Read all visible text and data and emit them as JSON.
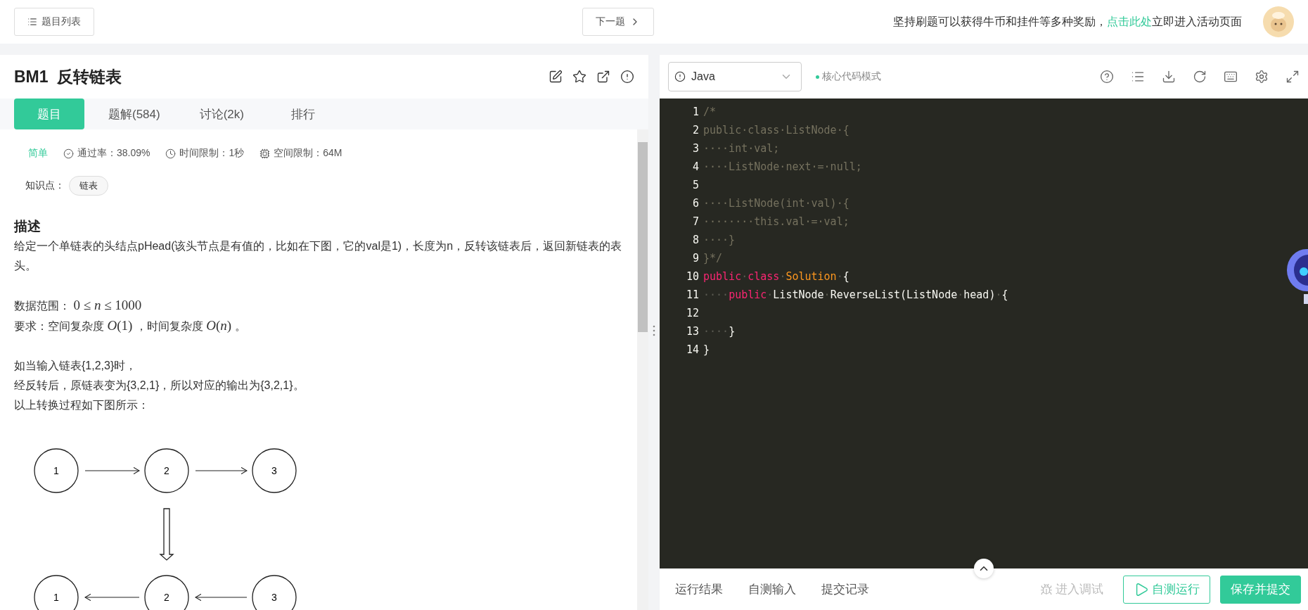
{
  "top_bar": {
    "problem_list_button": "题目列表",
    "next_button": "下一题",
    "banner": {
      "before": "坚持刷题可以获得牛币和挂件等多种奖励，",
      "link": "点击此处",
      "after": "立即进入活动页面"
    }
  },
  "problem": {
    "title": "BM1  反转链表",
    "tabs": [
      {
        "label": "题目",
        "selected": true
      },
      {
        "label": "题解(584)",
        "selected": false
      },
      {
        "label": "讨论(2k)",
        "selected": false
      },
      {
        "label": "排行",
        "selected": false
      }
    ],
    "difficulty": "简单",
    "meta": [
      {
        "kind": "pass-rate",
        "text": "通过率：38.09%"
      },
      {
        "kind": "time",
        "text": "时间限制：1秒"
      },
      {
        "kind": "memory",
        "text": "空间限制：64M"
      }
    ],
    "knowledge_label": "知识点：",
    "tags": [
      "链表"
    ],
    "description": {
      "heading": "描述",
      "paragraphs": [
        [
          [
            {
              "kind": "text",
              "text": "给定一个单链表的头结点pHead(该头节点是有值的，比如在下图，它的val是1)，长度为n，反转该链表后，返回新链表的表头。"
            }
          ]
        ],
        [
          [
            {
              "kind": "text",
              "text": "数据范围： "
            },
            {
              "kind": "math",
              "text": "0 ≤ *n* ≤ 1000"
            }
          ],
          [
            {
              "kind": "text",
              "text": "要求：空间复杂度 "
            },
            {
              "kind": "math",
              "text": "*O*(1)"
            },
            {
              "kind": "text",
              "text": " ，时间复杂度 "
            },
            {
              "kind": "math",
              "text": "*O*(*n*)"
            },
            {
              "kind": "text",
              "text": " 。"
            }
          ]
        ],
        [
          [
            {
              "kind": "text",
              "text": "如当输入链表{1,2,3}时，"
            }
          ],
          [
            {
              "kind": "text",
              "text": "经反转后，原链表变为{3,2,1}，所以对应的输出为{3,2,1}。"
            }
          ],
          [
            {
              "kind": "text",
              "text": "以上转换过程如下图所示："
            }
          ]
        ]
      ]
    },
    "diagram": {
      "rows": [
        {
          "kind": "forward",
          "nodes": [
            "1",
            "2",
            "3"
          ]
        },
        {
          "kind": "backward",
          "nodes": [
            "1",
            "2",
            "3"
          ]
        }
      ]
    }
  },
  "editor": {
    "language": "Java",
    "mode": "核心代码模式",
    "lines": [
      {
        "number": "1",
        "tokens": [
          {
            "kind": "comment",
            "text": "/*"
          }
        ]
      },
      {
        "number": "2",
        "tokens": [
          {
            "kind": "comment",
            "text": "public·class·ListNode·{"
          }
        ]
      },
      {
        "number": "3",
        "tokens": [
          {
            "kind": "comment",
            "text": "····int·val;"
          }
        ]
      },
      {
        "number": "4",
        "tokens": [
          {
            "kind": "comment",
            "text": "····ListNode·next·=·null;"
          }
        ]
      },
      {
        "number": "5"
      },
      {
        "number": "6",
        "tokens": [
          {
            "kind": "comment",
            "text": "····ListNode(int·val)·{"
          }
        ]
      },
      {
        "number": "7",
        "tokens": [
          {
            "kind": "comment",
            "text": "········this.val·=·val;"
          }
        ]
      },
      {
        "number": "8",
        "tokens": [
          {
            "kind": "comment",
            "text": "····}"
          }
        ]
      },
      {
        "number": "9",
        "tokens": [
          {
            "kind": "comment",
            "text": "}*/"
          }
        ]
      },
      {
        "number": "10",
        "tokens": [
          {
            "kind": "keyword",
            "text": "public"
          },
          {
            "kind": "space",
            "text": "·"
          },
          {
            "kind": "keyword",
            "text": "class"
          },
          {
            "kind": "space",
            "text": "·"
          },
          {
            "kind": "type",
            "text": "Solution"
          },
          {
            "kind": "space",
            "text": "·"
          },
          {
            "kind": "plain",
            "text": "{"
          }
        ]
      },
      {
        "number": "11",
        "tokens": [
          {
            "kind": "space",
            "text": "····"
          },
          {
            "kind": "keyword",
            "text": "public"
          },
          {
            "kind": "space",
            "text": "·"
          },
          {
            "kind": "plain",
            "text": "ListNode"
          },
          {
            "kind": "space",
            "text": "·"
          },
          {
            "kind": "plain",
            "text": "ReverseList(ListNode"
          },
          {
            "kind": "space",
            "text": "·"
          },
          {
            "kind": "plain",
            "text": "head)"
          },
          {
            "kind": "space",
            "text": "·"
          },
          {
            "kind": "plain",
            "text": "{"
          }
        ]
      },
      {
        "number": "12"
      },
      {
        "number": "13",
        "tokens": [
          {
            "kind": "space",
            "text": "····"
          },
          {
            "kind": "plain",
            "text": "}"
          }
        ]
      },
      {
        "number": "14",
        "tokens": [
          {
            "kind": "plain",
            "text": "}"
          }
        ]
      }
    ]
  },
  "bottom_bar": {
    "tabs": [
      "运行结果",
      "自测输入",
      "提交记录"
    ],
    "buttons": [
      {
        "kind": "debug",
        "label": "进入调试",
        "disabled": true
      },
      {
        "kind": "outline",
        "label": "自测运行",
        "disabled": false
      },
      {
        "kind": "primary",
        "label": "保存并提交",
        "disabled": false
      }
    ]
  }
}
